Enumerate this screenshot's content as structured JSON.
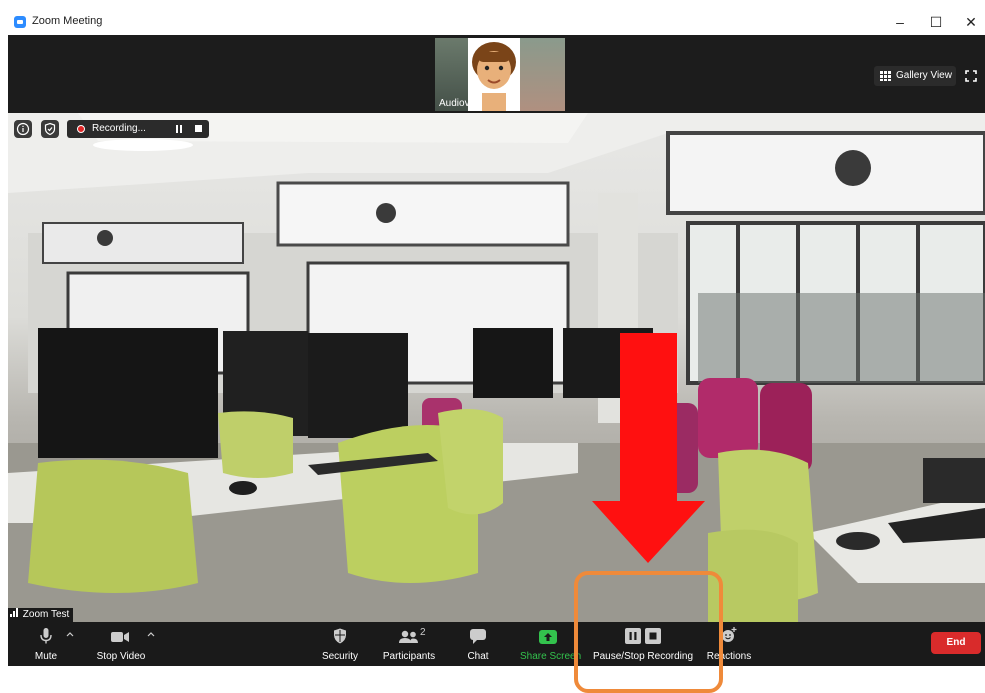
{
  "window": {
    "title": "Zoom Meeting"
  },
  "thumbnail": {
    "label": "Audiov"
  },
  "view": {
    "gallery_label": "Gallery View"
  },
  "recording": {
    "status": "Recording..."
  },
  "video": {
    "participant_name": "Zoom Test"
  },
  "toolbar": {
    "mute": "Mute",
    "stop_video": "Stop Video",
    "security": "Security",
    "participants": "Participants",
    "participants_count": "2",
    "chat": "Chat",
    "share_screen": "Share Screen",
    "pause_stop_recording": "Pause/Stop Recording",
    "reactions": "Reactions",
    "end": "End"
  },
  "colors": {
    "share_green": "#33c24d",
    "end_red": "#d92b2b",
    "highlight_orange": "#ef8a3a",
    "arrow_red": "#ff1010",
    "recording_red": "#e02828"
  },
  "icons": [
    "app-icon",
    "minimize-icon",
    "maximize-icon",
    "close-icon",
    "gallery-grid-icon",
    "fullscreen-icon",
    "info-icon",
    "shield-icon",
    "record-dot-icon",
    "pause-icon",
    "stop-icon",
    "signal-icon",
    "microphone-icon",
    "video-camera-icon",
    "chevron-up-icon",
    "security-shield-icon",
    "participants-icon",
    "chat-icon",
    "share-arrow-icon",
    "reactions-icon",
    "down-arrow-annotation"
  ]
}
